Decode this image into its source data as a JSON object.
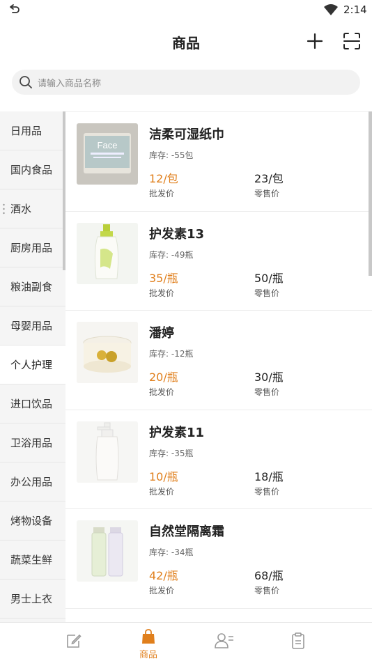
{
  "status_bar": {
    "time": "2:14"
  },
  "header": {
    "title": "商品"
  },
  "search": {
    "placeholder": "请输入商品名称"
  },
  "categories": [
    {
      "label": "日用品"
    },
    {
      "label": "国内食品"
    },
    {
      "label": "酒水"
    },
    {
      "label": "厨房用品"
    },
    {
      "label": "粮油副食"
    },
    {
      "label": "母婴用品"
    },
    {
      "label": "个人护理",
      "active": true
    },
    {
      "label": "进口饮品"
    },
    {
      "label": "卫浴用品"
    },
    {
      "label": "办公用品"
    },
    {
      "label": "烤物设备"
    },
    {
      "label": "蔬菜生鲜"
    },
    {
      "label": "男士上衣"
    }
  ],
  "products": [
    {
      "name": "洁柔可湿纸巾",
      "stock": "库存: -55包",
      "wholesale_price": "12/包",
      "wholesale_label": "批发价",
      "retail_price": "23/包",
      "retail_label": "零售价",
      "image_text": "Face"
    },
    {
      "name": "护发素13",
      "stock": "库存: -49瓶",
      "wholesale_price": "35/瓶",
      "wholesale_label": "批发价",
      "retail_price": "50/瓶",
      "retail_label": "零售价"
    },
    {
      "name": "潘婷",
      "stock": "库存: -12瓶",
      "wholesale_price": "20/瓶",
      "wholesale_label": "批发价",
      "retail_price": "30/瓶",
      "retail_label": "零售价"
    },
    {
      "name": "护发素11",
      "stock": "库存: -35瓶",
      "wholesale_price": "10/瓶",
      "wholesale_label": "批发价",
      "retail_price": "18/瓶",
      "retail_label": "零售价"
    },
    {
      "name": "自然堂隔离霜",
      "stock": "库存: -34瓶",
      "wholesale_price": "42/瓶",
      "wholesale_label": "批发价",
      "retail_price": "68/瓶",
      "retail_label": "零售价"
    }
  ],
  "bottom_nav": {
    "products_label": "商品"
  },
  "colors": {
    "accent": "#e07f1c",
    "sidebar_bg": "#f5f5f5"
  }
}
